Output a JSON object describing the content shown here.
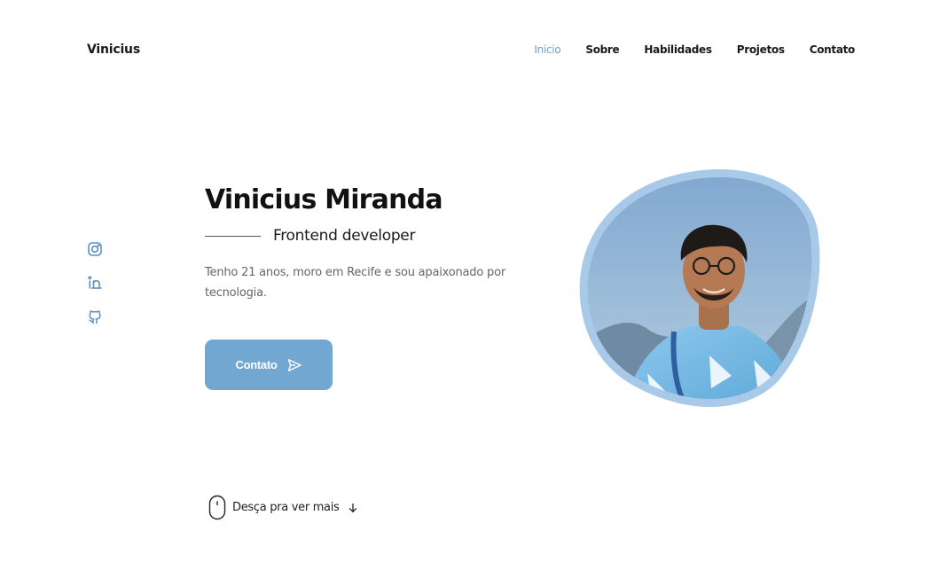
{
  "header": {
    "brand": "Vinicius",
    "nav": [
      {
        "label": "Inicio",
        "active": true
      },
      {
        "label": "Sobre",
        "active": false
      },
      {
        "label": "Habilidades",
        "active": false
      },
      {
        "label": "Projetos",
        "active": false
      },
      {
        "label": "Contato",
        "active": false
      }
    ]
  },
  "social": [
    {
      "icon": "instagram-icon"
    },
    {
      "icon": "linkedin-icon"
    },
    {
      "icon": "github-icon"
    }
  ],
  "hero": {
    "title": "Vinicius Miranda",
    "subtitle": "Frontend developer",
    "description": "Tenho 21 anos, moro em Recife e sou apaixonado por tecnologia.",
    "cta_label": "Contato",
    "cta_icon": "send-icon"
  },
  "scroll_hint": {
    "label": "Desça pra ver mais",
    "icon": "mouse-icon",
    "arrow": "arrow-down-icon"
  },
  "colors": {
    "accent": "#72a7d1",
    "nav_active": "#6fa1cc",
    "text": "#1a1a1a",
    "muted": "#666666",
    "blob_border": "#a9c9e8"
  }
}
